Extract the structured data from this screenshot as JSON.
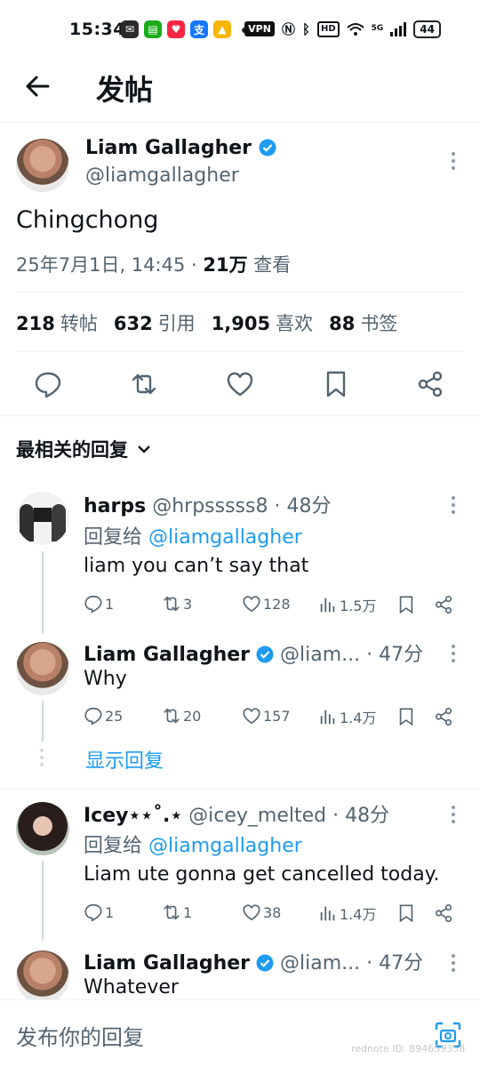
{
  "status_bar": {
    "time": "15:34",
    "vpn": "VPN",
    "hd": "HD",
    "network": "5G",
    "battery": "44",
    "app_icons": [
      "wechat-icon",
      "messages-icon",
      "xiaohongshu-icon",
      "alipay-icon",
      "bag-icon"
    ]
  },
  "header": {
    "title": "发帖",
    "back_icon": "arrow-left-icon"
  },
  "tweet": {
    "author_name": "Liam Gallagher",
    "author_handle": "@liamgallagher",
    "text": "Chingchong",
    "timestamp": "25年7月1日, 14:45 · ",
    "views_count": "21万",
    "views_label": " 查看",
    "stats": [
      {
        "count": "218",
        "label": "转帖"
      },
      {
        "count": "632",
        "label": "引用"
      },
      {
        "count": "1,905",
        "label": "喜欢"
      },
      {
        "count": "88",
        "label": "书签"
      }
    ]
  },
  "sort_label": "最相关的回复",
  "replies": [
    {
      "name": "harps",
      "handle": "@hrpsssss8",
      "time": " · 48分",
      "reply_to_prefix": "回复给 ",
      "reply_to": "@liamgallagher",
      "text": "liam you can’t say that",
      "replies": "1",
      "retweets": "3",
      "likes": "128",
      "views": "1.5万"
    },
    {
      "name": "Liam Gallagher",
      "handle": "@liam...",
      "time": " · 47分",
      "text": "Why",
      "replies": "25",
      "retweets": "20",
      "likes": "157",
      "views": "1.4万"
    },
    {
      "name": "Icey⋆⋆˚.⋆",
      "handle": "@icey_melted",
      "time": " · 48分",
      "reply_to_prefix": "回复给 ",
      "reply_to": "@liamgallagher",
      "text": "Liam ute gonna get cancelled today.",
      "replies": "1",
      "retweets": "1",
      "likes": "38",
      "views": "1.4万"
    },
    {
      "name": "Liam Gallagher",
      "handle": "@liam...",
      "time": " · 47分",
      "text": "Whatever"
    }
  ],
  "show_replies_label": "显示回复",
  "composer": {
    "placeholder": "发布你的回复"
  },
  "watermark": "rednote ID: 894659358",
  "colors": {
    "link": "#1d9bf0",
    "secondary_text": "#536471",
    "text": "#0f1419",
    "divider": "#eff3f4"
  }
}
